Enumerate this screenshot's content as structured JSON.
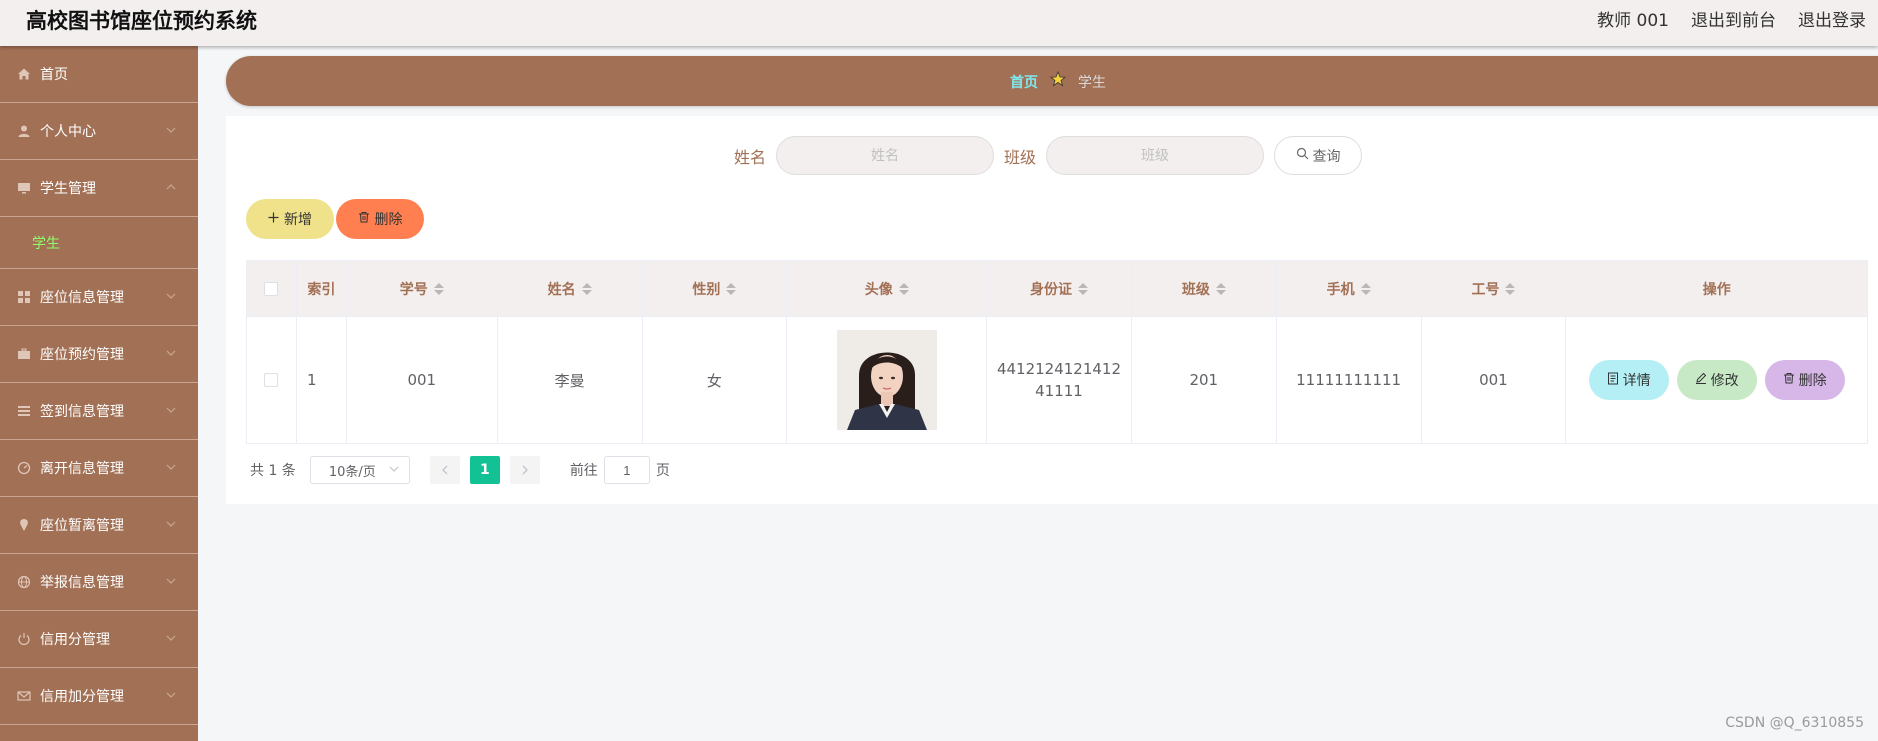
{
  "header": {
    "title": "高校图书馆座位预约系统",
    "user": "教师 001",
    "to_front": "退出到前台",
    "logout": "退出登录"
  },
  "sidebar": {
    "items": [
      {
        "label": "首页",
        "icon": "home-icon"
      },
      {
        "label": "个人中心",
        "icon": "user-icon"
      },
      {
        "label": "学生管理",
        "icon": "monitor-icon"
      },
      {
        "label": "学生",
        "sub": true
      },
      {
        "label": "座位信息管理",
        "icon": "grid-icon"
      },
      {
        "label": "座位预约管理",
        "icon": "briefcase-icon"
      },
      {
        "label": "签到信息管理",
        "icon": "list-icon"
      },
      {
        "label": "离开信息管理",
        "icon": "gauge-icon"
      },
      {
        "label": "座位暂离管理",
        "icon": "pin-icon"
      },
      {
        "label": "举报信息管理",
        "icon": "globe-icon"
      },
      {
        "label": "信用分管理",
        "icon": "power-icon"
      },
      {
        "label": "信用加分管理",
        "icon": "mail-icon"
      }
    ]
  },
  "breadcrumb": {
    "home": "首页",
    "current": "学生"
  },
  "search": {
    "name_label": "姓名",
    "name_placeholder": "姓名",
    "class_label": "班级",
    "class_placeholder": "班级",
    "query_button": "查询"
  },
  "actions": {
    "add": "新增",
    "delete": "删除"
  },
  "table": {
    "headers": {
      "index": "索引",
      "student_no": "学号",
      "name": "姓名",
      "gender": "性别",
      "avatar": "头像",
      "id_card": "身份证",
      "class": "班级",
      "phone": "手机",
      "work_no": "工号",
      "operation": "操作"
    },
    "rows": [
      {
        "index": "1",
        "student_no": "001",
        "name": "李曼",
        "gender": "女",
        "id_card": "441212412141241111",
        "class": "201",
        "phone": "11111111111",
        "work_no": "001"
      }
    ],
    "row_actions": {
      "detail": "详情",
      "edit": "修改",
      "delete": "删除"
    }
  },
  "pagination": {
    "total": "共 1 条",
    "page_size": "10条/页",
    "current_page": "1",
    "goto_prefix": "前往",
    "goto_value": "1",
    "goto_suffix": "页"
  },
  "watermark": "CSDN @Q_6310855",
  "colors": {
    "sidebar": "#a27055",
    "header": "#f4efef",
    "accent_green": "#13c294",
    "add_button": "#f0e28a",
    "delete_button": "#ff7f50"
  }
}
